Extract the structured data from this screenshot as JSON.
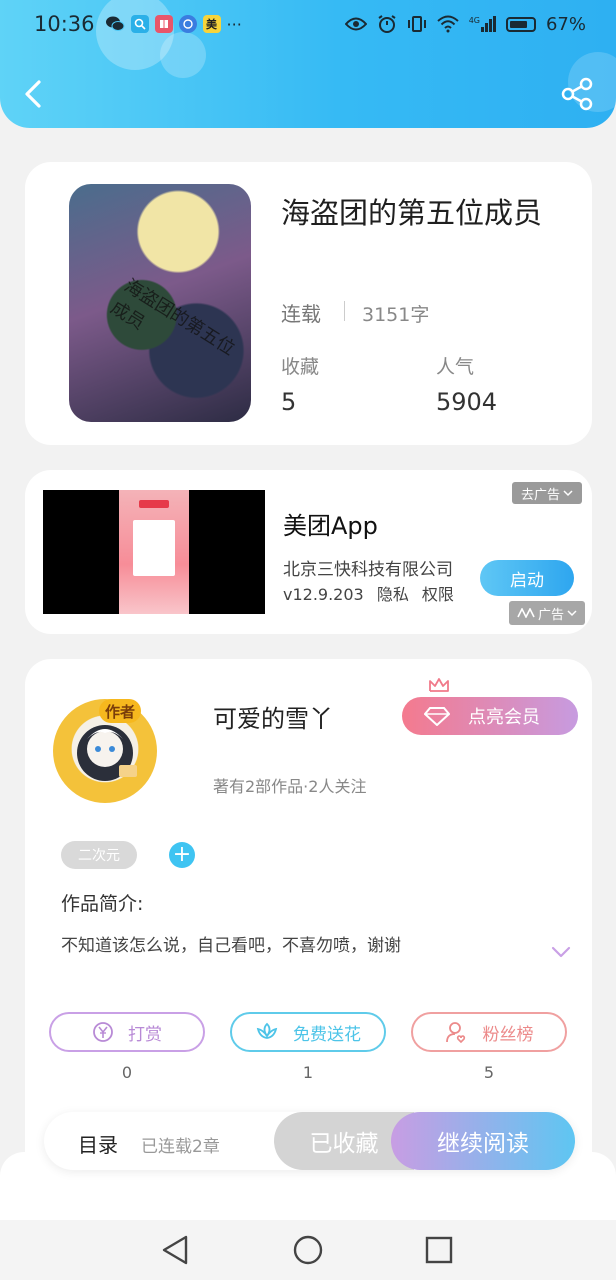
{
  "status_bar": {
    "time": "10:36",
    "battery": "67%",
    "notifications": [
      "wechat-icon",
      "search-app-icon",
      "book-app-icon",
      "browser-icon",
      "meituan-icon"
    ],
    "more": "···",
    "meituan_glyph": "美",
    "signal_label": "4G"
  },
  "book": {
    "title": "海盗团的第五位成员",
    "status": "连载",
    "word_count": "3151字",
    "favorites_label": "收藏",
    "favorites_value": "5",
    "popularity_label": "人气",
    "popularity_value": "5904",
    "cover_text": "海盗团的第五位成员"
  },
  "ad": {
    "remove_label": "去广告",
    "title": "美团App",
    "company": "北京三快科技有限公司",
    "version": "v12.9.203",
    "privacy": "隐私",
    "permissions": "权限",
    "launch": "启动",
    "label": "广告"
  },
  "author": {
    "name": "可爱的雪丫",
    "badge": "作者",
    "stats": "著有2部作品·2人关注",
    "vip_button": "点亮会员",
    "tag": "二次元",
    "intro_label": "作品简介:",
    "intro_text": "不知道该怎么说，自己看吧，不喜勿喷，谢谢"
  },
  "actions": {
    "tip": {
      "label": "打赏",
      "count": "0",
      "color": "#b88ad6"
    },
    "flower": {
      "label": "免费送花",
      "count": "1",
      "color": "#4dc4e8"
    },
    "fans": {
      "label": "粉丝榜",
      "count": "5",
      "color": "#ec8a8a"
    }
  },
  "bottom_bar": {
    "toc": "目录",
    "chapters": "已连载2章",
    "collected": "已收藏",
    "continue": "继续阅读"
  },
  "colors": {
    "header": "#36baf4",
    "accent_blue": "#3fc4f2",
    "accent_purple": "#c89de3"
  }
}
